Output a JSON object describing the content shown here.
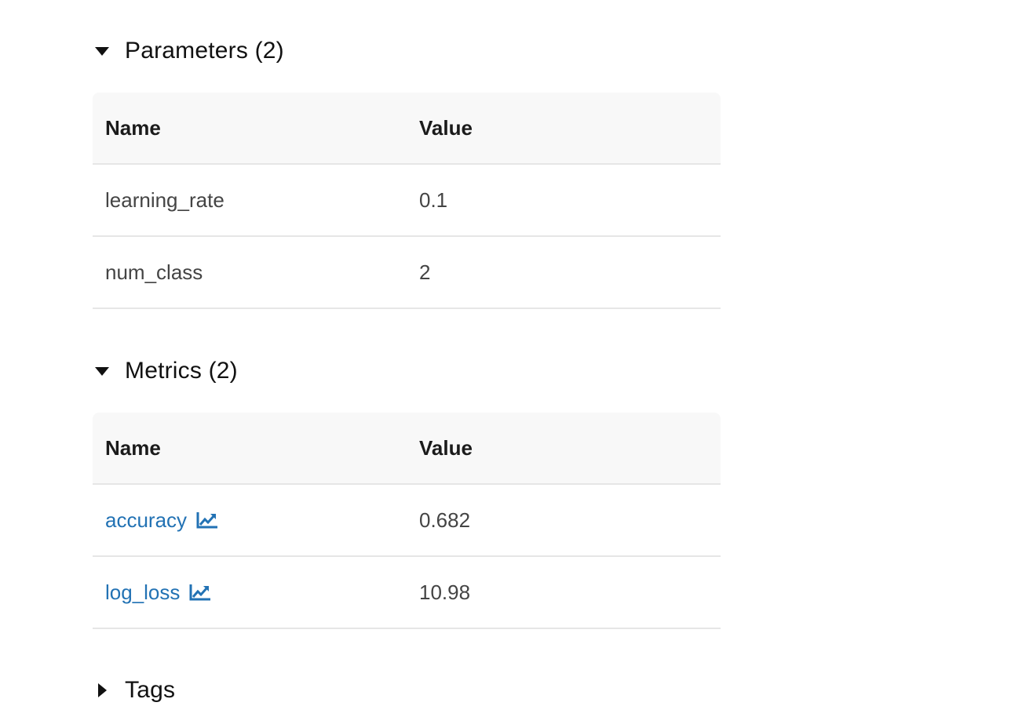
{
  "parameters": {
    "title": "Parameters (2)",
    "headers": {
      "name": "Name",
      "value": "Value"
    },
    "rows": [
      {
        "name": "learning_rate",
        "value": "0.1"
      },
      {
        "name": "num_class",
        "value": "2"
      }
    ]
  },
  "metrics": {
    "title": "Metrics (2)",
    "headers": {
      "name": "Name",
      "value": "Value"
    },
    "rows": [
      {
        "name": "accuracy",
        "value": "0.682",
        "icon": "line-chart-icon"
      },
      {
        "name": "log_loss",
        "value": "10.98",
        "icon": "line-chart-icon"
      }
    ]
  },
  "tags": {
    "title": "Tags"
  },
  "colors": {
    "link": "#2272b4",
    "header_bg": "#f8f8f8",
    "divider": "#e6e6e6"
  }
}
